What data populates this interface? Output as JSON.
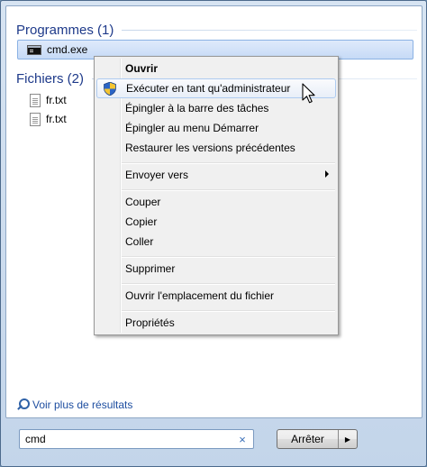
{
  "groups": {
    "programs_label": "Programmes (1)",
    "files_label": "Fichiers (2)"
  },
  "programs": [
    {
      "label": "cmd.exe",
      "icon": "cmd-icon"
    }
  ],
  "files": [
    {
      "label": "fr.txt",
      "icon": "text-file-icon"
    },
    {
      "label": "fr.txt",
      "icon": "text-file-icon"
    }
  ],
  "more_results": "Voir plus de résultats",
  "search": {
    "value": "cmd",
    "clear_glyph": "×"
  },
  "stop_button": {
    "label": "Arrêter",
    "arrow": "▶"
  },
  "context_menu": {
    "open": "Ouvrir",
    "run_as_admin": "Exécuter en tant qu'administrateur",
    "pin_taskbar": "Épingler à la barre des tâches",
    "pin_start": "Épingler au menu Démarrer",
    "restore": "Restaurer les versions précédentes",
    "send_to": "Envoyer vers",
    "cut": "Couper",
    "copy": "Copier",
    "paste": "Coller",
    "delete": "Supprimer",
    "open_location": "Ouvrir l'emplacement du fichier",
    "properties": "Propriétés"
  },
  "colors": {
    "group_heading": "#1e3a8a",
    "selection": "#c6daf6",
    "link": "#1e4ea0"
  }
}
